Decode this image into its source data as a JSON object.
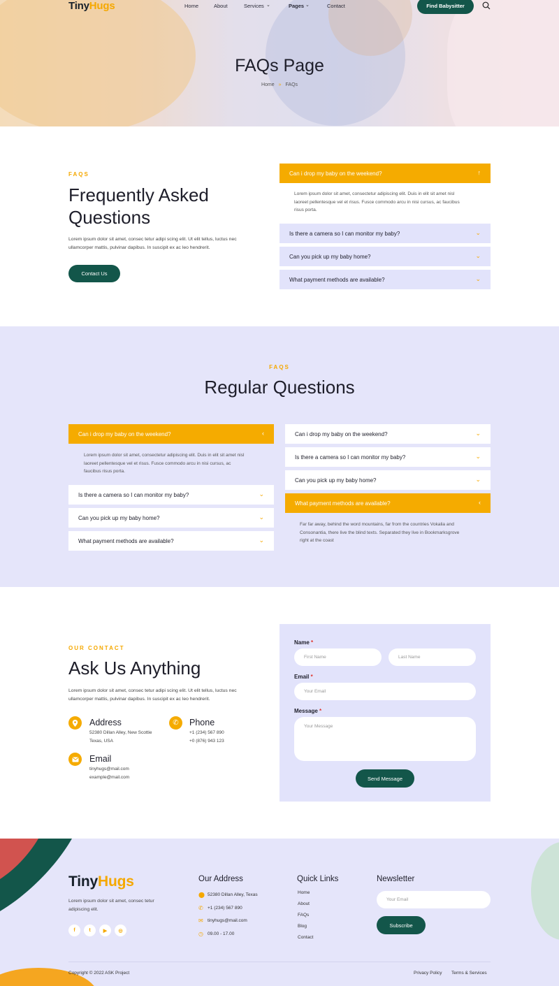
{
  "header": {
    "logo": {
      "part1": "Tiny",
      "part2": "Hugs"
    },
    "nav": [
      "Home",
      "About",
      "Services",
      "Pages",
      "Contact"
    ],
    "cta": "Find Babysitter",
    "title": "FAQs Page",
    "breadcrumb": {
      "home": "Home",
      "current": "FAQs"
    }
  },
  "faq_intro": {
    "eyebrow": "FAQS",
    "title_line1": "Frequently Asked",
    "title_line2": "Questions",
    "text_line1": "Lorem ipsum dolor sit amet, consec tetur adipi scing elit. Ut elit tellus, luctus nec",
    "text_line2": "ullamcorper mattis, pulvinar dapibus. In suscipit ex ac leo hendrerit.",
    "button": "Contact Us",
    "accordion": [
      {
        "q": "Can i drop my baby on the weekend?",
        "open": true,
        "a1": "Lorem ipsum dolor sit amet, consectetur adipiscing elit. Duis in elit sit amet nisl",
        "a2": "laoreet pellentesque vel et risus. Fusce commodo arcu in nisi cursus, ac faucibus",
        "a3": "risus porta."
      },
      {
        "q": "Is there a camera so I can monitor my baby?",
        "open": false
      },
      {
        "q": "Can you pick up my baby home?",
        "open": false
      },
      {
        "q": "What payment methods are available?",
        "open": false
      }
    ]
  },
  "regular": {
    "eyebrow": "FAQS",
    "title": "Regular Questions",
    "left": [
      {
        "q": "Can i drop my baby on the weekend?",
        "open": true,
        "a1": "Lorem ipsum dolor sit amet, consectetur adipiscing elit. Duis in elit sit amet nisl",
        "a2": "laoreet pellentesque vel et risus. Fusce commodo arcu in nisi cursus, ac",
        "a3": "faucibus risus porta."
      },
      {
        "q": "Is there a camera so I can monitor my baby?",
        "open": false
      },
      {
        "q": "Can you pick up my baby home?",
        "open": false
      },
      {
        "q": "What payment methods are available?",
        "open": false
      }
    ],
    "right": [
      {
        "q": "Can i drop my baby on the weekend?",
        "open": false
      },
      {
        "q": "Is there a camera so I can monitor my baby?",
        "open": false
      },
      {
        "q": "Can you pick up my baby home?",
        "open": false
      },
      {
        "q": "What payment methods are available?",
        "open": true,
        "a1": "Far far away, behind the word mountains, far from the countries Vokalia and",
        "a2": "Consonantia, there live the blind texts. Separated they live in Bookmarksgrove",
        "a3": "right at the coast"
      }
    ]
  },
  "contact": {
    "eyebrow": "OUR CONTACT",
    "title": "Ask Us Anything",
    "text_line1": "Lorem ipsum dolor sit amet, consec tetur adipi scing elit. Ut elit tellus, luctus nec",
    "text_line2": "ullamcorper mattis, pulvinar dapibus. In suscipit ex ac leo hendrerit.",
    "address": {
      "title": "Address",
      "l1": "52380 Dillan Alley, New Scottie",
      "l2": "Texas, USA"
    },
    "phone": {
      "title": "Phone",
      "l1": "+1 (234) 567 890",
      "l2": "+0 (876) 943 123"
    },
    "email": {
      "title": "Email",
      "l1": "tinyhugs@mail.com",
      "l2": "example@mail.com"
    },
    "form": {
      "name_label": "Name",
      "email_label": "Email",
      "message_label": "Message",
      "required": "*",
      "first_ph": "First Name",
      "last_ph": "Last Name",
      "email_ph": "Your Email",
      "message_ph": "Your Message",
      "submit": "Send Message"
    }
  },
  "footer": {
    "about": "Lorem ipsum dolor sit amet, consec tetur",
    "about2": "adipiscing elit.",
    "address_title": "Our Address",
    "address": "52380 Dillan Alley, Texas",
    "phone": "+1 (234) 567 890",
    "email": "tinyhugs@mail.com",
    "hours": "09.00 - 17.00",
    "links_title": "Quick Links",
    "links": [
      "Home",
      "About",
      "FAQs",
      "Blog",
      "Contact"
    ],
    "newsletter_title": "Newsletter",
    "newsletter_ph": "Your Email",
    "subscribe": "Subscribe",
    "copyright": "Copyright © 2022 ASK Project",
    "privacy": "Privacy Policy",
    "terms": "Terms & Services",
    "social": [
      "facebook-icon",
      "twitter-icon",
      "youtube-icon",
      "instagram-icon"
    ]
  },
  "colors": {
    "accent": "#f5ab00",
    "dark_green": "#13564a",
    "lavender": "#e5e5fa"
  }
}
